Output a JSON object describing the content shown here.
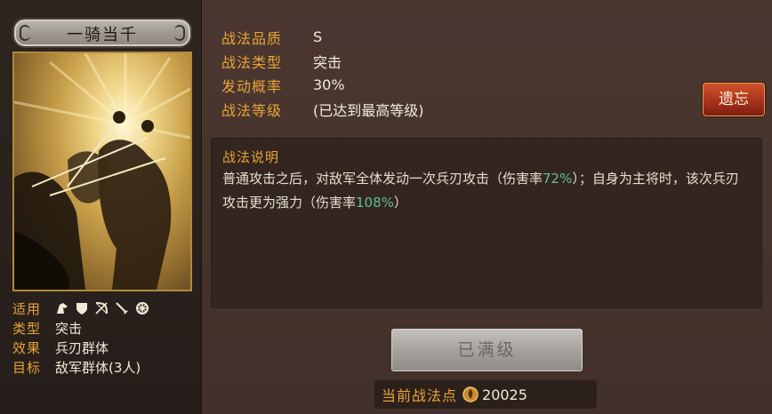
{
  "skill": {
    "name": "一骑当千",
    "info": {
      "applicable_label": "适用",
      "type_label": "类型",
      "type_value": "突击",
      "effect_label": "效果",
      "effect_value": "兵刃群体",
      "target_label": "目标",
      "target_value": "敌军群体(3人)",
      "applicable_icons": [
        "cavalry-icon",
        "shield-icon",
        "bow-icon",
        "spear-icon",
        "siege-icon"
      ]
    },
    "properties": [
      {
        "label": "战法品质",
        "value": "S"
      },
      {
        "label": "战法类型",
        "value": "突击"
      },
      {
        "label": "发动概率",
        "value": "30%"
      },
      {
        "label": "战法等级",
        "value": "(已达到最高等级)"
      }
    ],
    "forget_label": "遗忘",
    "description": {
      "title": "战法说明",
      "part1": "普通攻击之后，对敌军全体发动一次兵刃攻击（伤害率",
      "rate1": "72%",
      "part2": "）；自身为主将时，该次兵刃攻击更为强力（伤害率",
      "rate2": "108%",
      "part3": "）"
    },
    "maxed_label": "已满级",
    "points_label": "当前战法点",
    "points_value": "20025"
  },
  "colors": {
    "label_gold": "#e8a437",
    "highlight_green": "#5fc08e",
    "forget_red": "#a3301c"
  }
}
